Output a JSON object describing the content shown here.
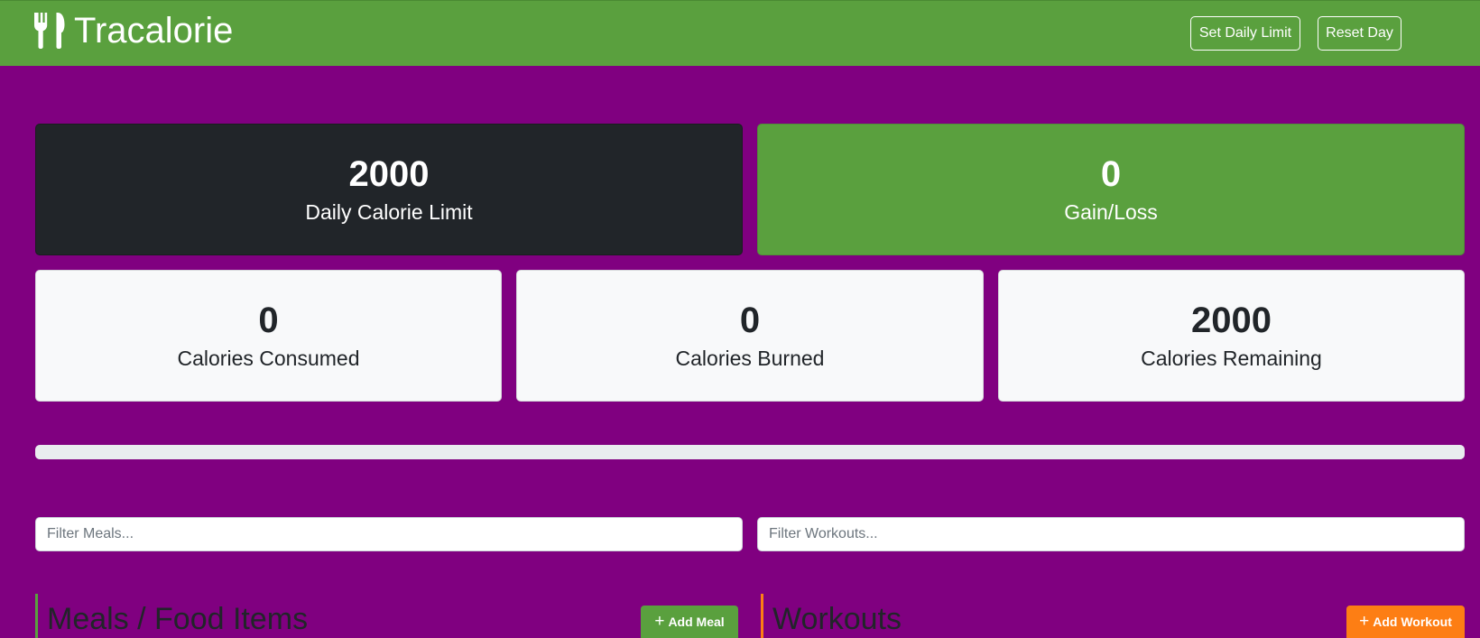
{
  "navbar": {
    "brand": "Tracalorie",
    "brand_icon": "utensils-icon",
    "set_limit_label": "Set Daily Limit",
    "reset_label": "Reset Day"
  },
  "stats": {
    "limit": {
      "value": "2000",
      "label": "Daily Calorie Limit"
    },
    "gain_loss": {
      "value": "0",
      "label": "Gain/Loss"
    },
    "consumed": {
      "value": "0",
      "label": "Calories Consumed"
    },
    "burned": {
      "value": "0",
      "label": "Calories Burned"
    },
    "remaining": {
      "value": "2000",
      "label": "Calories Remaining"
    }
  },
  "progress": {
    "percent": 0
  },
  "filters": {
    "meals_placeholder": "Filter Meals...",
    "workouts_placeholder": "Filter Workouts..."
  },
  "meals": {
    "title": "Meals / Food Items",
    "add_label": "Add Meal",
    "add_icon": "plus-icon"
  },
  "workouts": {
    "title": "Workouts",
    "add_label": "Add Workout",
    "add_icon": "plus-icon"
  },
  "colors": {
    "page_bg": "#800080",
    "navbar": "#5aa03e",
    "dark_card": "#212529",
    "light_card": "#f8f9fa",
    "meal_accent": "#5aa03e",
    "workout_accent": "#fd7e14"
  }
}
